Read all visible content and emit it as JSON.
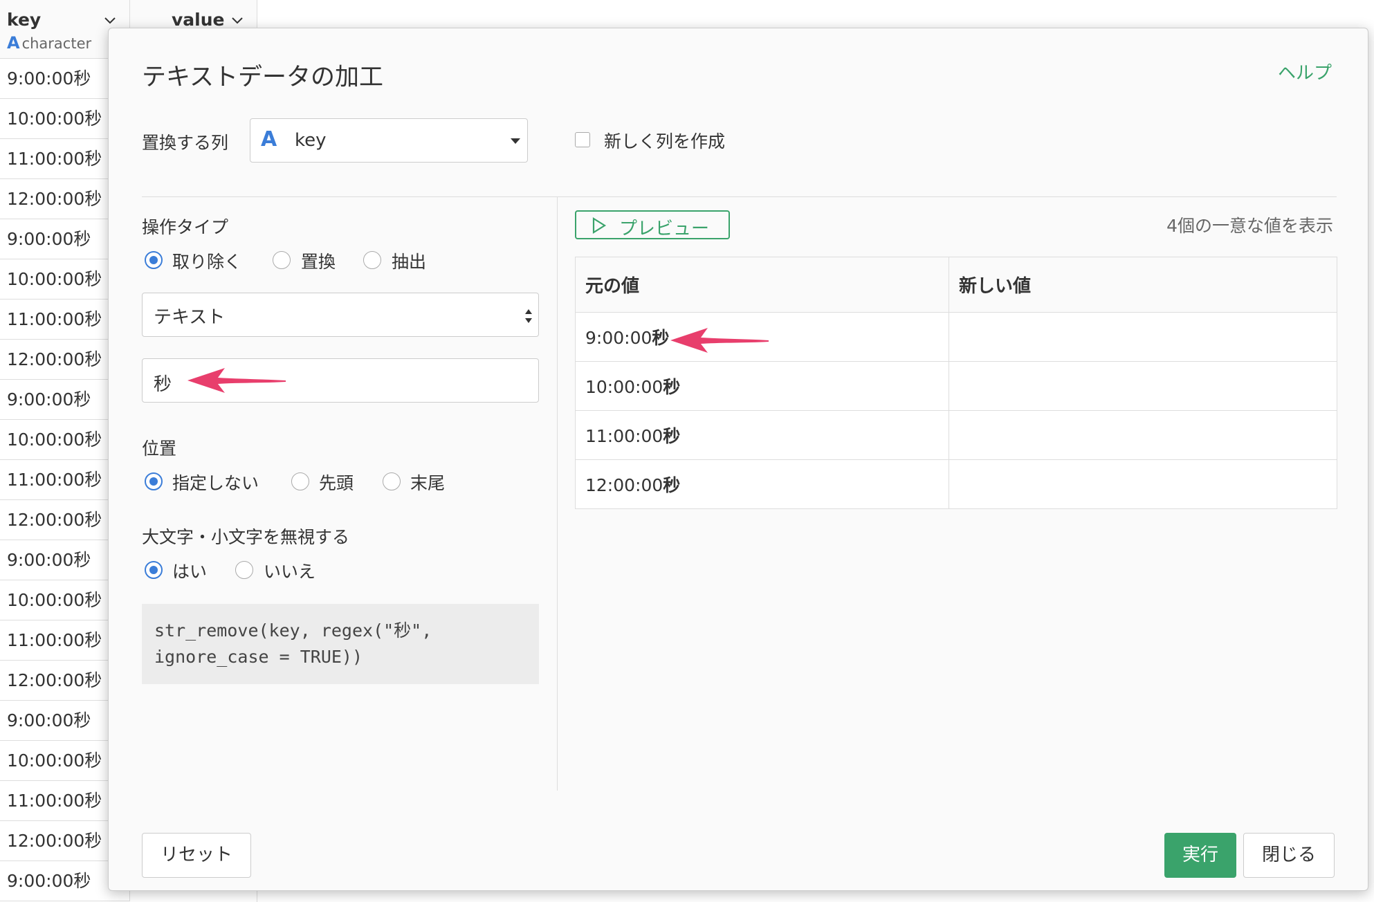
{
  "grid": {
    "key_header": "key",
    "key_type": "character",
    "value_header": "value",
    "rows": [
      "9:00:00秒",
      "10:00:00秒",
      "11:00:00秒",
      "12:00:00秒",
      "9:00:00秒",
      "10:00:00秒",
      "11:00:00秒",
      "12:00:00秒",
      "9:00:00秒",
      "10:00:00秒",
      "11:00:00秒",
      "12:00:00秒",
      "9:00:00秒",
      "10:00:00秒",
      "11:00:00秒",
      "12:00:00秒",
      "9:00:00秒",
      "10:00:00秒",
      "11:00:00秒",
      "12:00:00秒",
      "9:00:00秒"
    ]
  },
  "dialog": {
    "title": "テキストデータの加工",
    "help": "ヘルプ",
    "replace_col_label": "置換する列",
    "col_select_value": "key",
    "new_col_label": "新しく列を作成",
    "op_type_label": "操作タイプ",
    "op_types": [
      "取り除く",
      "置換",
      "抽出"
    ],
    "text_select_value": "テキスト",
    "input_value": "秒",
    "position_label": "位置",
    "positions": [
      "指定しない",
      "先頭",
      "末尾"
    ],
    "ignore_case_label": "大文字・小文字を無視する",
    "ignore_case_options": [
      "はい",
      "いいえ"
    ],
    "code_line1": "str_remove(key, regex(\"秒\",",
    "code_line2": "ignore_case = TRUE))",
    "preview_button": "プレビュー",
    "unique_note": "4個の一意な値を表示",
    "table_headers": [
      "元の値",
      "新しい値"
    ],
    "table_rows": [
      {
        "base": "9:00:00",
        "match": "秒"
      },
      {
        "base": "10:00:00",
        "match": "秒"
      },
      {
        "base": "11:00:00",
        "match": "秒"
      },
      {
        "base": "12:00:00",
        "match": "秒"
      }
    ],
    "reset_button": "リセット",
    "run_button": "実行",
    "close_button": "閉じる"
  },
  "colors": {
    "accent_green": "#3aa36b",
    "accent_blue": "#3b7dd8",
    "arrow_pink": "#e83e6c"
  }
}
